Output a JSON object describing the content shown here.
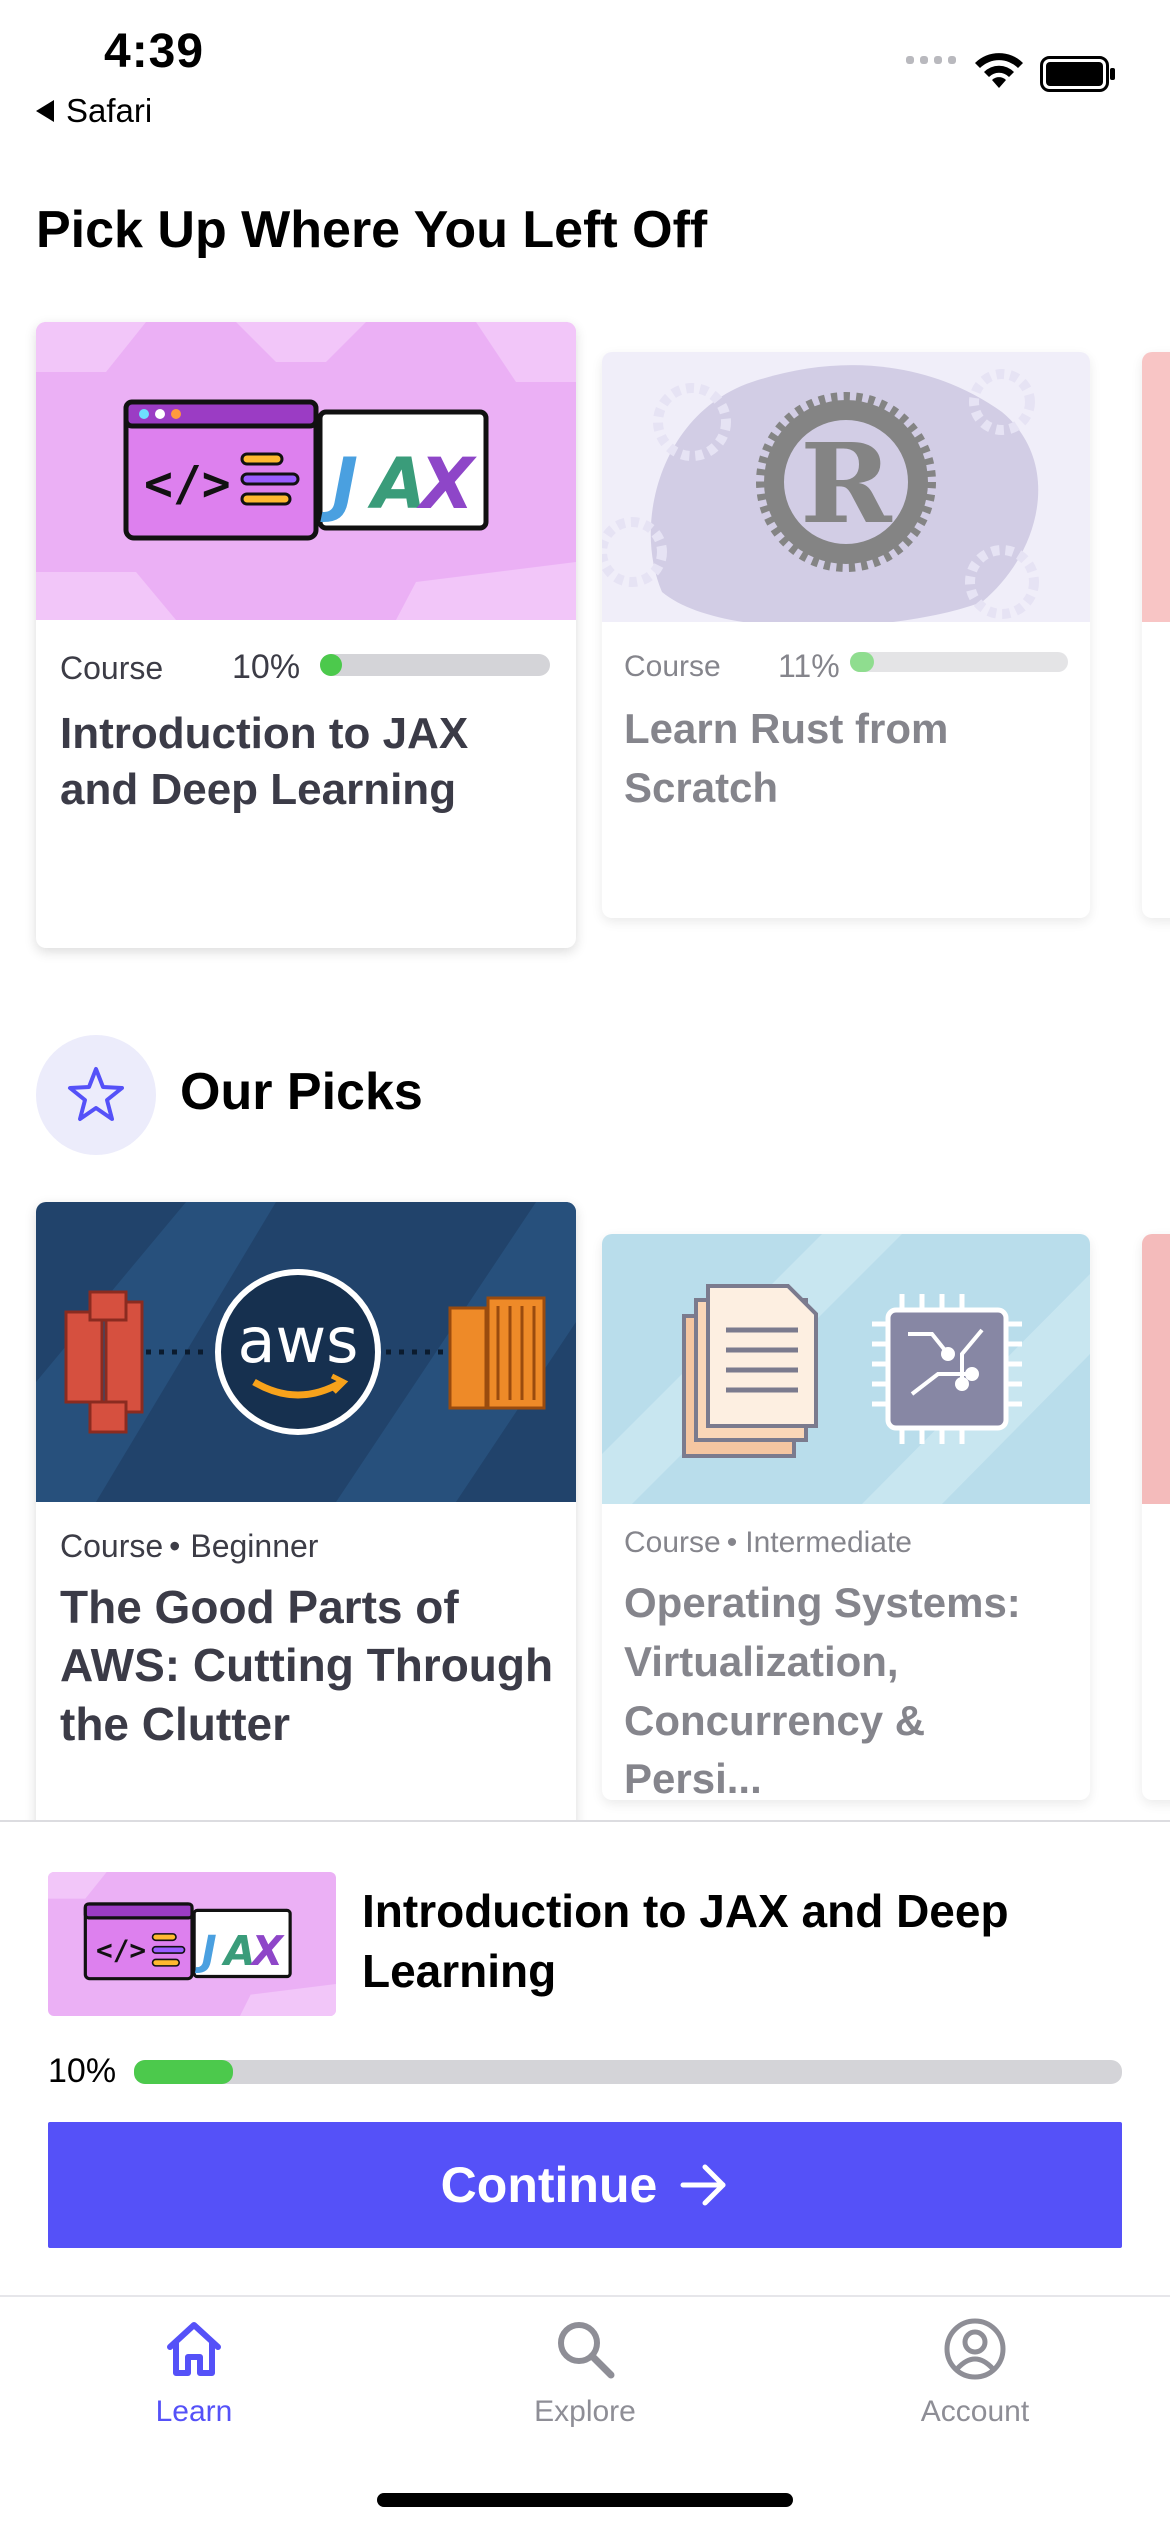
{
  "status_bar": {
    "time": "4:39",
    "back_app": "Safari"
  },
  "continue_section": {
    "title": "Pick Up Where You Left Off",
    "cards": [
      {
        "type": "Course",
        "progress_label": "10%",
        "progress": 0.1,
        "title": "Introduction to JAX and Deep Learning"
      },
      {
        "type": "Course",
        "progress_label": "11%",
        "progress": 0.11,
        "title": "Learn Rust from Scratch"
      }
    ]
  },
  "picks_section": {
    "title": "Our Picks",
    "icon": "star-icon",
    "cards": [
      {
        "type": "Course",
        "level": "Beginner",
        "title": "The Good Parts of AWS: Cutting Through the Clutter",
        "thumb_text": "aws"
      },
      {
        "type": "Course",
        "level": "Intermediate",
        "title": "Operating Systems: Virtualization, Concurrency & Persi..."
      }
    ]
  },
  "resume_panel": {
    "title": "Introduction to JAX and Deep Learning",
    "progress_label": "10%",
    "progress": 0.1,
    "button_label": "Continue",
    "button_color": "#5551f8"
  },
  "tab_bar": {
    "tabs": [
      {
        "label": "Learn",
        "icon": "home-icon",
        "active": true
      },
      {
        "label": "Explore",
        "icon": "search-icon",
        "active": false
      },
      {
        "label": "Account",
        "icon": "account-icon",
        "active": false
      }
    ],
    "active_color": "#5551f8",
    "inactive_color": "#8e8e96"
  },
  "colors": {
    "progress_green": "#4cc94c",
    "accent": "#5551f8"
  }
}
